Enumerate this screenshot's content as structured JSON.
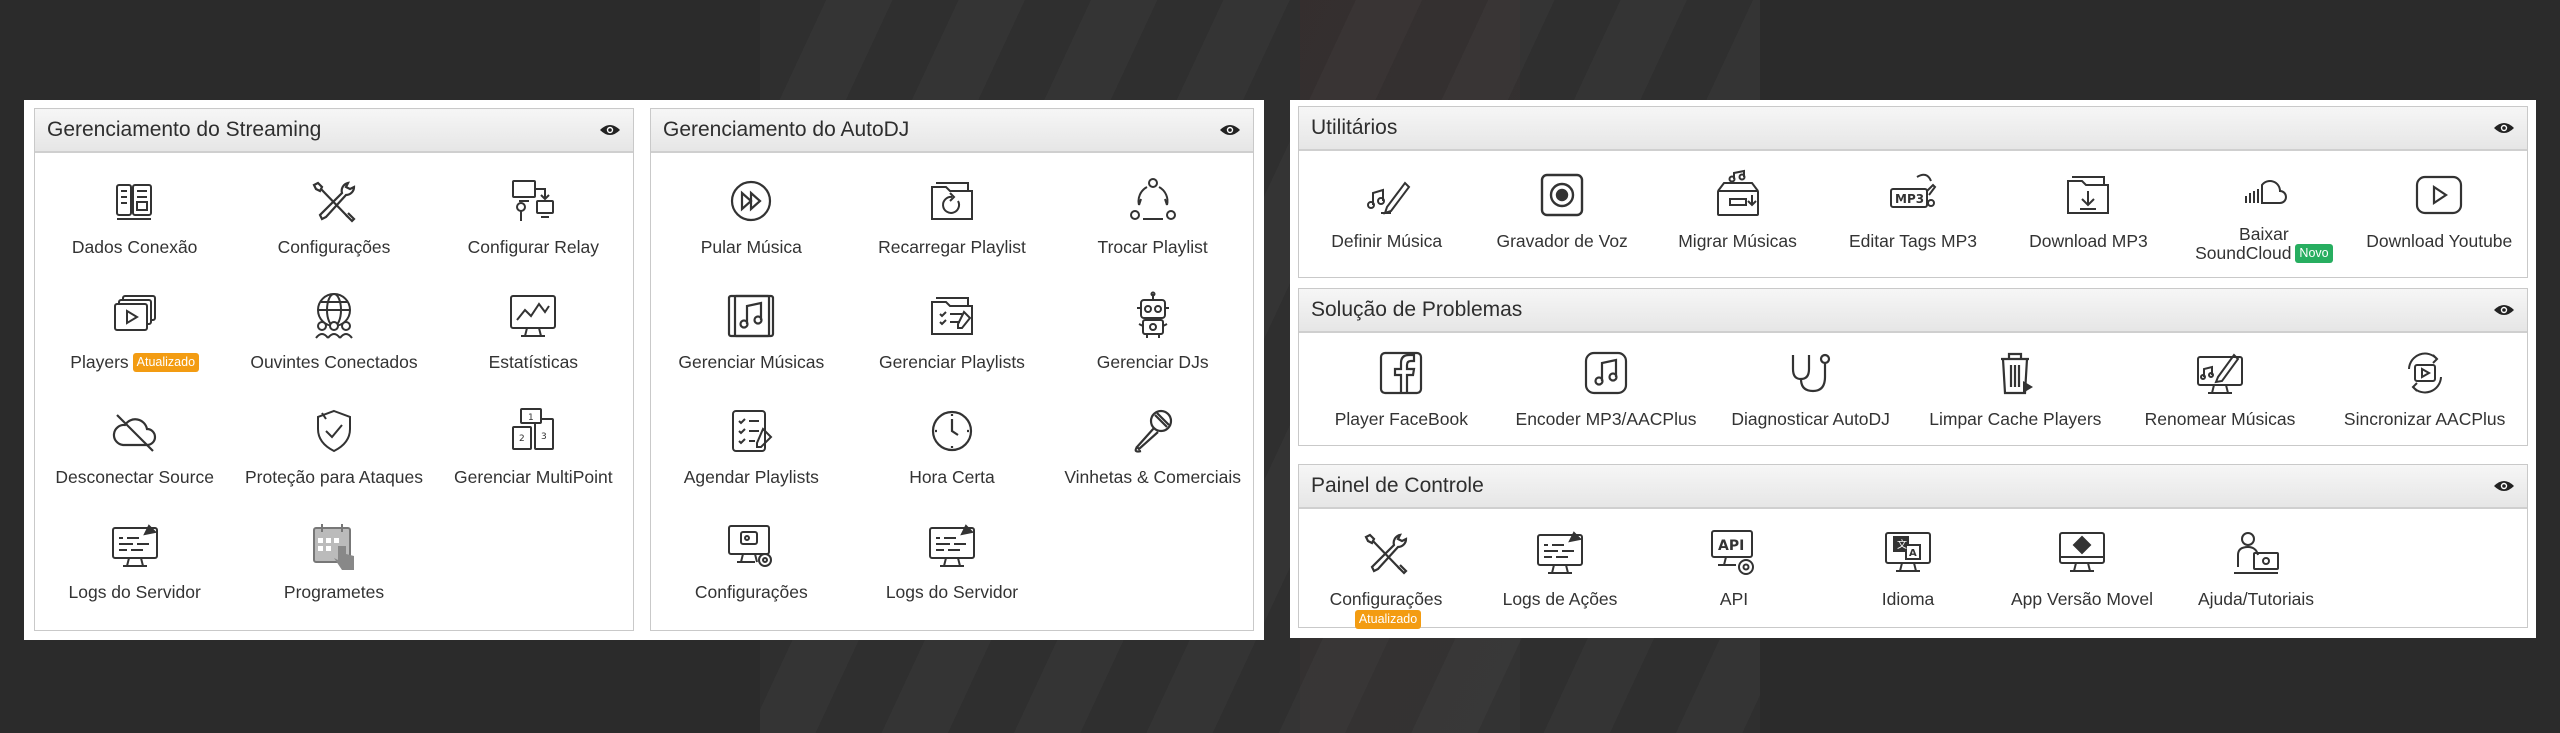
{
  "colors": {
    "badge_updated": "#f39c12",
    "badge_new": "#27ae60",
    "panel_border": "#c9c9c9",
    "background": "#2b2b2b"
  },
  "streaming": {
    "title": "Gerenciamento do Streaming",
    "items": [
      {
        "label": "Dados Conexão",
        "icon": "connection-data-icon"
      },
      {
        "label": "Configurações",
        "icon": "tools-icon"
      },
      {
        "label": "Configurar Relay",
        "icon": "relay-icon"
      },
      {
        "label": "Players",
        "badge": "Atualizado",
        "icon": "video-player-icon"
      },
      {
        "label": "Ouvintes Conectados",
        "icon": "globe-people-icon"
      },
      {
        "label": "Estatísticas",
        "icon": "statistics-monitor-icon"
      },
      {
        "label": "Desconectar Source",
        "icon": "cloud-off-icon"
      },
      {
        "label": "Proteção para Ataques",
        "icon": "shield-icon"
      },
      {
        "label": "Gerenciar MultiPoint",
        "icon": "multipoint-icon"
      },
      {
        "label": "Logs do Servidor",
        "icon": "server-log-icon"
      },
      {
        "label": "Programetes",
        "icon": "calendar-hand-icon"
      }
    ]
  },
  "autodj": {
    "title": "Gerenciamento do AutoDJ",
    "items": [
      {
        "label": "Pular Música",
        "icon": "fast-forward-icon"
      },
      {
        "label": "Recarregar Playlist",
        "icon": "reload-folder-icon"
      },
      {
        "label": "Trocar Playlist",
        "icon": "swap-playlist-icon"
      },
      {
        "label": "Gerenciar Músicas",
        "icon": "music-album-icon"
      },
      {
        "label": "Gerenciar Playlists",
        "icon": "playlist-folder-icon"
      },
      {
        "label": "Gerenciar DJs",
        "icon": "robot-dj-icon"
      },
      {
        "label": "Agendar Playlists",
        "icon": "schedule-checklist-icon"
      },
      {
        "label": "Hora Certa",
        "icon": "clock-icon"
      },
      {
        "label": "Vinhetas & Comerciais",
        "icon": "microphone-icon"
      },
      {
        "label": "Configurações",
        "icon": "monitor-gear-icon"
      },
      {
        "label": "Logs do Servidor",
        "icon": "server-log-icon"
      }
    ]
  },
  "utilities": {
    "title": "Utilitários",
    "items": [
      {
        "label": "Definir Música",
        "icon": "music-pen-icon"
      },
      {
        "label": "Gravador de Voz",
        "icon": "record-icon"
      },
      {
        "label": "Migrar Músicas",
        "icon": "migrate-box-icon"
      },
      {
        "label": "Editar Tags MP3",
        "icon": "mp3-tag-icon"
      },
      {
        "label": "Download MP3",
        "icon": "download-folder-icon"
      },
      {
        "label_line1": "Baixar",
        "label_line2": "SoundCloud",
        "badge": "Novo",
        "icon": "soundcloud-icon"
      },
      {
        "label": "Download Youtube",
        "icon": "youtube-play-icon"
      }
    ]
  },
  "troubleshooting": {
    "title": "Solução de Problemas",
    "items": [
      {
        "label": "Player FaceBook",
        "icon": "facebook-icon"
      },
      {
        "label": "Encoder MP3/AACPlus",
        "icon": "music-file-icon"
      },
      {
        "label": "Diagnosticar AutoDJ",
        "icon": "stethoscope-icon"
      },
      {
        "label": "Limpar Cache Players",
        "icon": "trash-icon"
      },
      {
        "label": "Renomear Músicas",
        "icon": "monitor-edit-icon"
      },
      {
        "label": "Sincronizar AACPlus",
        "icon": "sync-play-icon"
      }
    ]
  },
  "control_panel": {
    "title": "Painel de Controle",
    "items": [
      {
        "label": "Configurações",
        "badge": "Atualizado",
        "icon": "tools-icon"
      },
      {
        "label": "Logs de Ações",
        "icon": "server-log-icon"
      },
      {
        "label": "API",
        "icon": "api-gear-icon"
      },
      {
        "label": "Idioma",
        "icon": "language-icon"
      },
      {
        "label": "App Versão Movel",
        "icon": "monitor-app-icon"
      },
      {
        "label": "Ajuda/Tutoriais",
        "icon": "help-tutorial-icon"
      }
    ]
  }
}
